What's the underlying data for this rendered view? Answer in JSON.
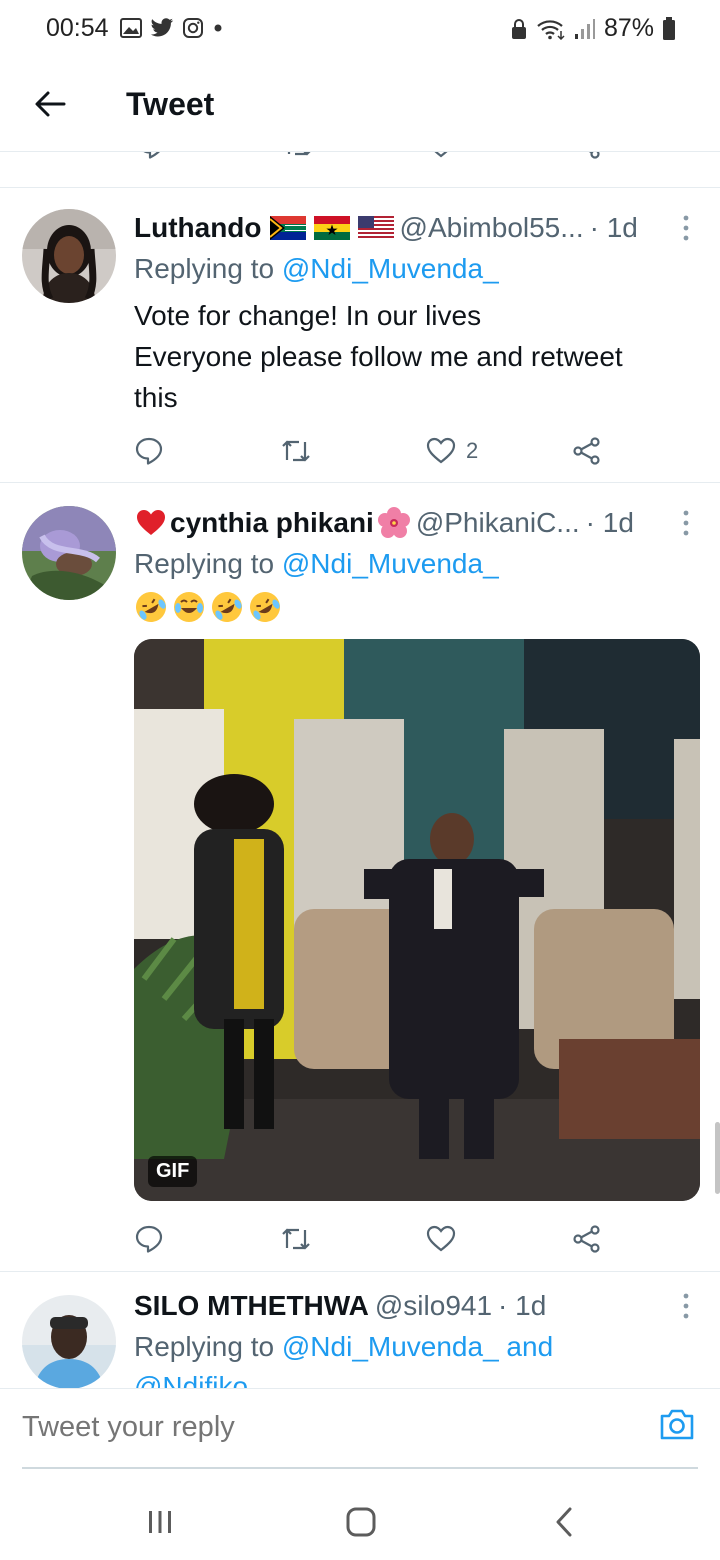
{
  "status_bar": {
    "time": "00:54",
    "battery": "87%",
    "left_icons": [
      "gallery-icon",
      "twitter-bird-icon",
      "instagram-icon",
      "dot-icon"
    ],
    "right_icons": [
      "lock-icon",
      "wifi-icon",
      "signal-icon",
      "battery-icon"
    ]
  },
  "header": {
    "title": "Tweet"
  },
  "tweets": [
    {
      "name": "Luthando",
      "name_suffix_emoji": [
        "south-africa-flag",
        "ghana-flag",
        "usa-flag"
      ],
      "handle": "@Abimbol55...",
      "time": "· 1d",
      "replying_prefix": "Replying to ",
      "replying_to": "@Ndi_Muvenda_",
      "text_lines": [
        "Vote for change! In our lives",
        "Everyone please follow me and retweet",
        "this"
      ],
      "likes": "2"
    },
    {
      "name": "cynthia phikani",
      "name_prefix_emoji": "heart",
      "name_suffix_emoji": "hibiscus",
      "handle": "@PhikaniC...",
      "time": "· 1d",
      "replying_prefix": "Replying to ",
      "replying_to": "@Ndi_Muvenda_",
      "emoji_line": [
        "rolling-on-floor-laughing",
        "tears-of-joy",
        "rolling-on-floor-laughing",
        "rolling-on-floor-laughing"
      ],
      "media_badge": "GIF",
      "likes": ""
    },
    {
      "name": "SILO MTHETHWA",
      "handle": "@silo941",
      "time": "· 1d",
      "replying_prefix": "Replying to ",
      "replying_to": "@Ndi_Muvenda_ and",
      "replying_to_cut": "@Ndifiko"
    }
  ],
  "composer": {
    "placeholder": "Tweet your reply"
  },
  "colors": {
    "accent": "#1d9bf0",
    "text": "#0f1419",
    "muted": "#536471",
    "divider": "#e6ecf0"
  }
}
